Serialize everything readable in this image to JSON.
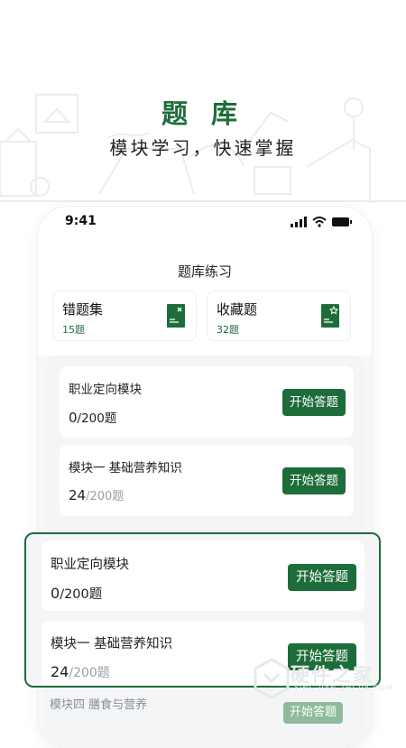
{
  "hero": {
    "title": "题 库",
    "subtitle": "模块学习，快速掌握"
  },
  "status_bar": {
    "time": "9:41"
  },
  "page": {
    "title": "题库练习"
  },
  "top_cards": [
    {
      "title": "错题集",
      "count": "15题",
      "icon": "wrong-notebook-icon"
    },
    {
      "title": "收藏题",
      "count": "32题",
      "icon": "favorite-notebook-icon"
    }
  ],
  "modules": [
    {
      "name": "职业定向模块",
      "done": "0",
      "total": "/200题",
      "button": "开始答题"
    },
    {
      "name": "模块一  基础营养知识",
      "done": "24",
      "total": "/200题",
      "button": "开始答题"
    }
  ],
  "highlight": [
    {
      "name": "职业定向模块",
      "done": "0",
      "total": "/200题",
      "button": "开始答题"
    },
    {
      "name": "模块一  基础营养知识",
      "done": "24",
      "total": "/200题",
      "button": "开始答题"
    }
  ],
  "faded": {
    "name": "模块四  膳食与营养",
    "button": "开始答题"
  },
  "watermark": {
    "text": "硬件之家",
    "sub": "YING JIAN ZHI JIA.COM"
  },
  "colors": {
    "brand": "#1d6d3a",
    "button_faded": "#8dbb9b",
    "muted": "#9aa0a6"
  }
}
